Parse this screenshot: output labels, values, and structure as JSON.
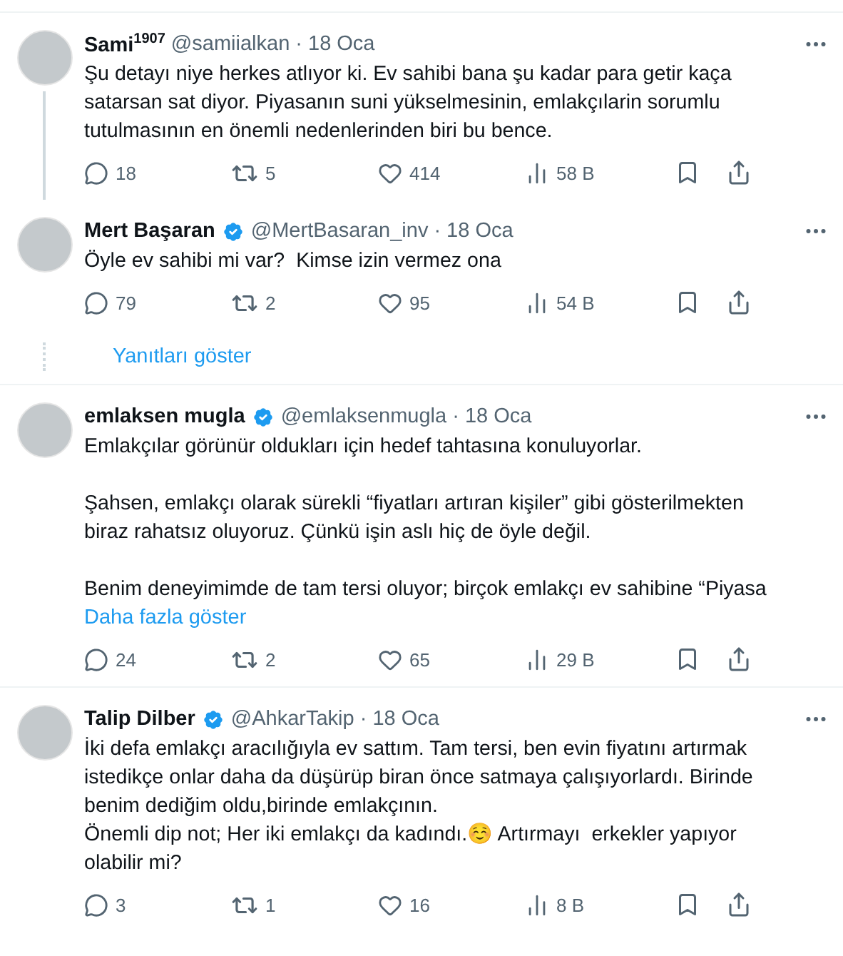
{
  "tweets": [
    {
      "name": "Sami$^{1907}$",
      "verified": false,
      "handle": "@samiialkan",
      "separator": "·",
      "date": "18 Oca",
      "thread_below": true,
      "text": "Şu detayı niye herkes atlıyor ki. Ev sahibi bana şu kadar para getir kaça\nsatarsan sat diyor. Piyasanın suni yükselmesinin, emlakçılarin sorumlu\ntutulmasının en önemli nedenlerinden biri bu bence.",
      "replies": "18",
      "reposts": "5",
      "likes": "414",
      "views": "58 B"
    },
    {
      "name": "Mert Başaran",
      "verified": true,
      "handle": "@MertBasaran_inv",
      "separator": "·",
      "date": "18 Oca",
      "thread_below": false,
      "text": "Öyle ev sahibi mi var?  Kimse izin vermez ona",
      "replies": "79",
      "reposts": "2",
      "likes": "95",
      "views": "54 B",
      "show_replies": "Yanıtları göster"
    },
    {
      "name": "emlaksen mugla",
      "verified": true,
      "handle": "@emlaksenmugla",
      "separator": "·",
      "date": "18 Oca",
      "thread_below": false,
      "text": "Emlakçılar görünür oldukları için hedef tahtasına konuluyorlar.\n\nŞahsen, emlakçı olarak sürekli “fiyatları artıran kişiler” gibi gösterilmekten\nbiraz rahatsız oluyoruz. Çünkü işin aslı hiç de öyle değil.\n\nBenim deneyimimde de tam tersi oluyor; birçok emlakçı ev sahibine “Piyasa",
      "show_more": "Daha fazla göster",
      "replies": "24",
      "reposts": "2",
      "likes": "65",
      "views": "29 B"
    },
    {
      "name": "Talip Dilber",
      "verified": true,
      "handle": "@AhkarTakip",
      "separator": "·",
      "date": "18 Oca",
      "thread_below": false,
      "text": "İki defa emlakçı aracılığıyla ev sattım. Tam tersi, ben evin fiyatını artırmak\nistedikçe onlar daha da düşürüp biran önce satmaya çalışıyorlardı. Birinde\nbenim dediğim oldu,birinde emlakçının.\nÖnemli dip not; Her iki emlakçı da kadındı.☺️ Artırmayı  erkekler yapıyor\nolabilir mi?",
      "replies": "3",
      "reposts": "1",
      "likes": "16",
      "views": "8 B"
    }
  ]
}
